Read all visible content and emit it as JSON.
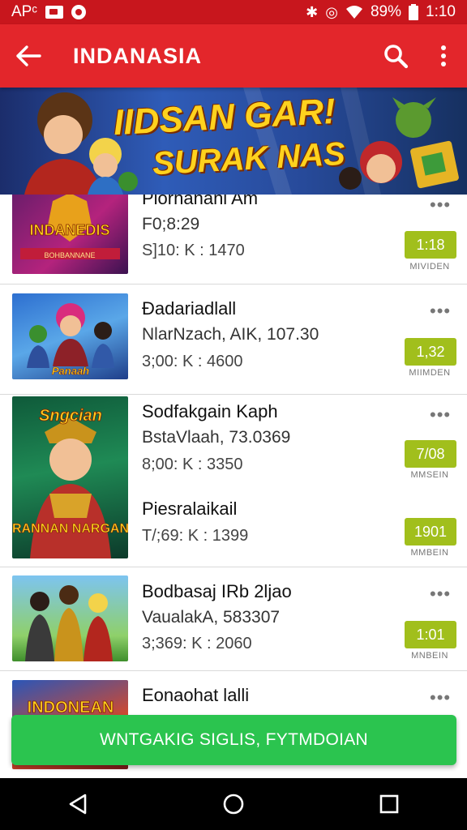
{
  "status_bar": {
    "carrier": "APᶜ",
    "battery": "89%",
    "time": "1:10"
  },
  "app_bar": {
    "title": "INDANASIA"
  },
  "banner": {
    "title": "IIDSAN GAR!",
    "subtitle": "SURAK NAS"
  },
  "theme": {
    "primary": "#e3262b",
    "status": "#c8161d",
    "badge": "#a1bf1c",
    "cta": "#2bc44f"
  },
  "items": [
    {
      "name": "Plorhanani Am",
      "meta": "F0;8:29",
      "price": "S]10: K : 1470",
      "badge": "1:18",
      "badge_caption": "MIVIDEN",
      "thumb_text": "INDANEDIS",
      "thumb_sub": "BOHBANNANE"
    },
    {
      "name": "Ðadariadlall",
      "meta": "NlarNzach, AIK, 107.30",
      "price": "3;00: K : 4600",
      "badge": "1,32",
      "badge_caption": "MIIMDEN",
      "thumb_text": "Panaah",
      "thumb_sub": ""
    },
    {
      "name": "Sodfakgain Kaph",
      "meta": "BstaVlaah, 73.0369",
      "price": "8;00: K : 3350",
      "badge": "7/08",
      "badge_caption": "MMSEIN",
      "thumb_text": "Sngcian",
      "thumb_sub": "RANNAN NARGAN"
    },
    {
      "name": "Piesralaikail",
      "meta": "",
      "price": "T/;69: K : 1399",
      "badge": "1901",
      "badge_caption": "MMBEIN",
      "thumb_text": "",
      "thumb_sub": ""
    },
    {
      "name": "Bodbasaj IRb 2ljao",
      "meta": "VaualakA, 583307",
      "price": "3;369: K : 2060",
      "badge": "1:01",
      "badge_caption": "MNBEIN",
      "thumb_text": "",
      "thumb_sub": ""
    },
    {
      "name": "Eonaohat lalli",
      "meta": "",
      "price": "",
      "badge": "",
      "badge_caption": "",
      "thumb_text": "INDONEAN",
      "thumb_sub": ""
    }
  ],
  "cta": {
    "label": "WNTGAKIG SIGLIS, FYTMDOIAN"
  },
  "icons": {
    "back": "arrow-left-icon",
    "search": "search-icon",
    "more": "more-vert-icon",
    "nav_back": "triangle-back-icon",
    "nav_home": "circle-home-icon",
    "nav_recents": "square-recents-icon"
  }
}
